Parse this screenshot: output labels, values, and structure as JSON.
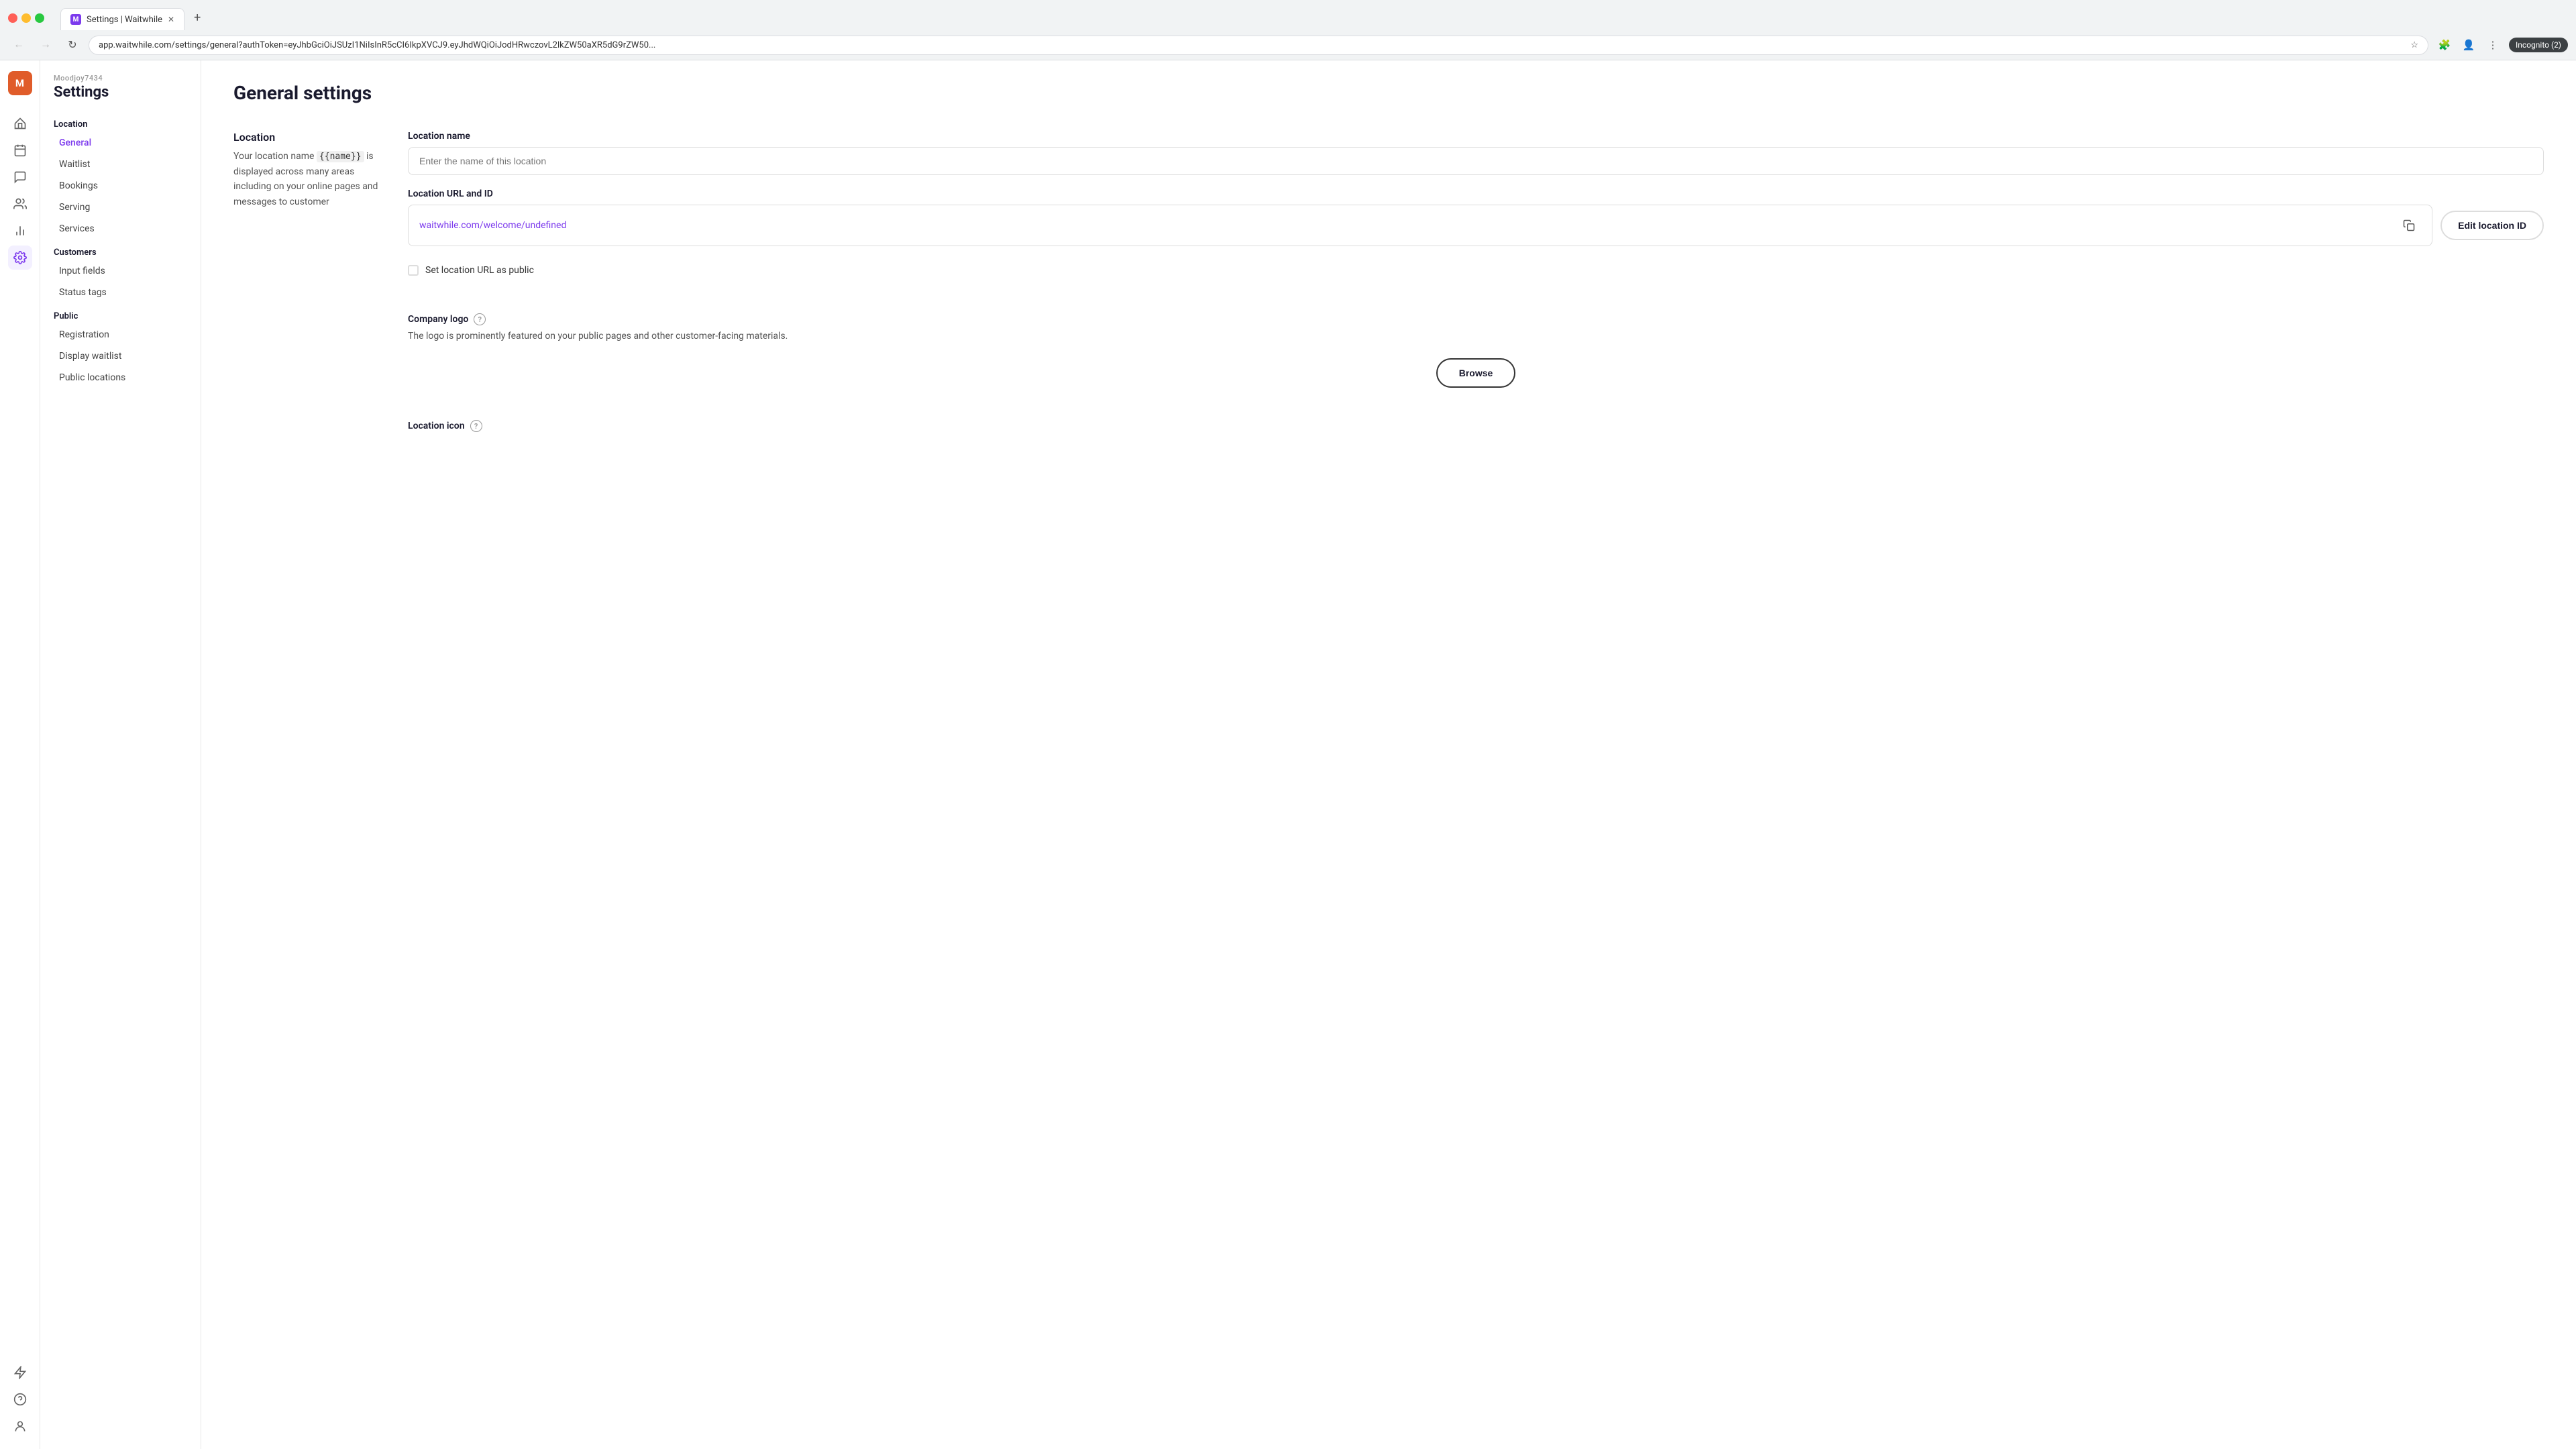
{
  "browser": {
    "tab_label": "Settings | Waitwhile",
    "url": "app.waitwhile.com/settings/general?authToken=eyJhbGciOiJSUzI1NiIsInR5cCI6IkpXVCJ9.eyJhdWQiOiJodHRwczovL2lkZW50aXR5dG9rZW50...",
    "new_tab_label": "+",
    "close_tab": "×",
    "incognito_label": "Incognito (2)"
  },
  "sidebar": {
    "brand": "Moodjoy7434",
    "title": "Settings",
    "location_header": "Location",
    "nav_items": [
      {
        "id": "general",
        "label": "General",
        "active": true
      },
      {
        "id": "waitlist",
        "label": "Waitlist",
        "active": false
      },
      {
        "id": "bookings",
        "label": "Bookings",
        "active": false
      },
      {
        "id": "serving",
        "label": "Serving",
        "active": false
      },
      {
        "id": "services",
        "label": "Services",
        "active": false
      }
    ],
    "customers_header": "Customers",
    "customers_items": [
      {
        "id": "input-fields",
        "label": "Input fields",
        "active": false
      },
      {
        "id": "status-tags",
        "label": "Status tags",
        "active": false
      }
    ],
    "public_header": "Public",
    "public_items": [
      {
        "id": "registration",
        "label": "Registration",
        "active": false
      },
      {
        "id": "display-waitlist",
        "label": "Display waitlist",
        "active": false
      },
      {
        "id": "public-locations",
        "label": "Public locations",
        "active": false
      }
    ]
  },
  "main": {
    "page_title": "General settings",
    "location_section": {
      "left_title": "Location",
      "description_part1": "Your location name ",
      "template_var": "{{name}}",
      "description_part2": " is displayed across many areas including on your online pages and messages to customer",
      "location_name_label": "Location name",
      "location_name_placeholder": "Enter the name of this location",
      "url_id_label": "Location URL and ID",
      "url_value": "waitwhile.com/welcome/undefined",
      "edit_id_btn": "Edit location ID",
      "set_public_label": "Set location URL as public"
    },
    "company_logo": {
      "label": "Company logo",
      "description": "The logo is prominently featured on your public pages and other customer-facing materials.",
      "browse_btn": "Browse"
    },
    "location_icon": {
      "label": "Location icon"
    }
  },
  "icons": {
    "home": "🏠",
    "calendar": "📅",
    "chat": "💬",
    "users": "👥",
    "chart": "📊",
    "gear": "⚙",
    "help": "?",
    "lightning": "⚡",
    "user_avatar": "M"
  }
}
